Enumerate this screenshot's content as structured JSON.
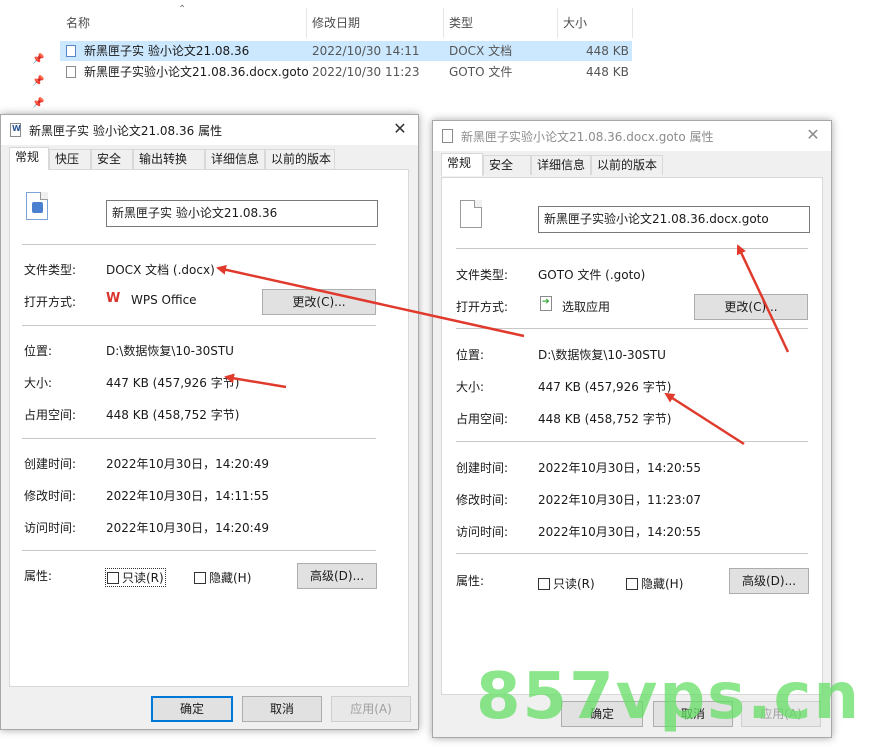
{
  "explorer": {
    "columns": [
      "名称",
      "修改日期",
      "类型",
      "大小"
    ],
    "files": [
      {
        "name": "新黑匣子实 验小论文21.08.36",
        "modified": "2022/10/30 14:11",
        "type": "DOCX 文档",
        "size": "448 KB"
      },
      {
        "name": "新黑匣子实验小论文21.08.36.docx.goto",
        "modified": "2022/10/30 11:23",
        "type": "GOTO 文件",
        "size": "448 KB"
      }
    ]
  },
  "dialog1": {
    "title": "新黑匣子实 验小论文21.08.36 属性",
    "tabs": [
      "常规",
      "快压",
      "安全",
      "输出转换",
      "详细信息",
      "以前的版本"
    ],
    "filename": "新黑匣子实 验小论文21.08.36",
    "file_type_label": "文件类型:",
    "file_type": "DOCX 文档 (.docx)",
    "open_with_label": "打开方式:",
    "open_with": "WPS Office",
    "change_button": "更改(C)...",
    "location_label": "位置:",
    "location": "D:\\数据恢复\\10-30STU",
    "size_label": "大小:",
    "size": "447 KB (457,926 字节)",
    "size_on_disk_label": "占用空间:",
    "size_on_disk": "448 KB (458,752 字节)",
    "created_label": "创建时间:",
    "created": "2022年10月30日，14:20:49",
    "modified_label": "修改时间:",
    "modified": "2022年10月30日，14:11:55",
    "accessed_label": "访问时间:",
    "accessed": "2022年10月30日，14:20:49",
    "attributes_label": "属性:",
    "readonly": "只读(R)",
    "hidden": "隐藏(H)",
    "advanced_button": "高级(D)...",
    "ok": "确定",
    "cancel": "取消",
    "apply": "应用(A)"
  },
  "dialog2": {
    "title": "新黑匣子实验小论文21.08.36.docx.goto 属性",
    "tabs": [
      "常规",
      "安全",
      "详细信息",
      "以前的版本"
    ],
    "filename": "新黑匣子实验小论文21.08.36.docx.goto",
    "file_type_label": "文件类型:",
    "file_type": "GOTO 文件 (.goto)",
    "open_with_label": "打开方式:",
    "open_with": "选取应用",
    "change_button": "更改(C)...",
    "location_label": "位置:",
    "location": "D:\\数据恢复\\10-30STU",
    "size_label": "大小:",
    "size": "447 KB (457,926 字节)",
    "size_on_disk_label": "占用空间:",
    "size_on_disk": "448 KB (458,752 字节)",
    "created_label": "创建时间:",
    "created": "2022年10月30日，14:20:55",
    "modified_label": "修改时间:",
    "modified": "2022年10月30日，11:23:07",
    "accessed_label": "访问时间:",
    "accessed": "2022年10月30日，14:20:55",
    "attributes_label": "属性:",
    "readonly": "只读(R)",
    "hidden": "隐藏(H)",
    "advanced_button": "高级(D)...",
    "ok": "确定",
    "cancel": "取消",
    "apply": "应用(A)"
  },
  "watermark": "857vps.cn",
  "colors": {
    "annotation_arrow": "#e03a2c",
    "watermark": "#66de66",
    "selection": "#cce8ff",
    "focus_border": "#0078d7"
  }
}
